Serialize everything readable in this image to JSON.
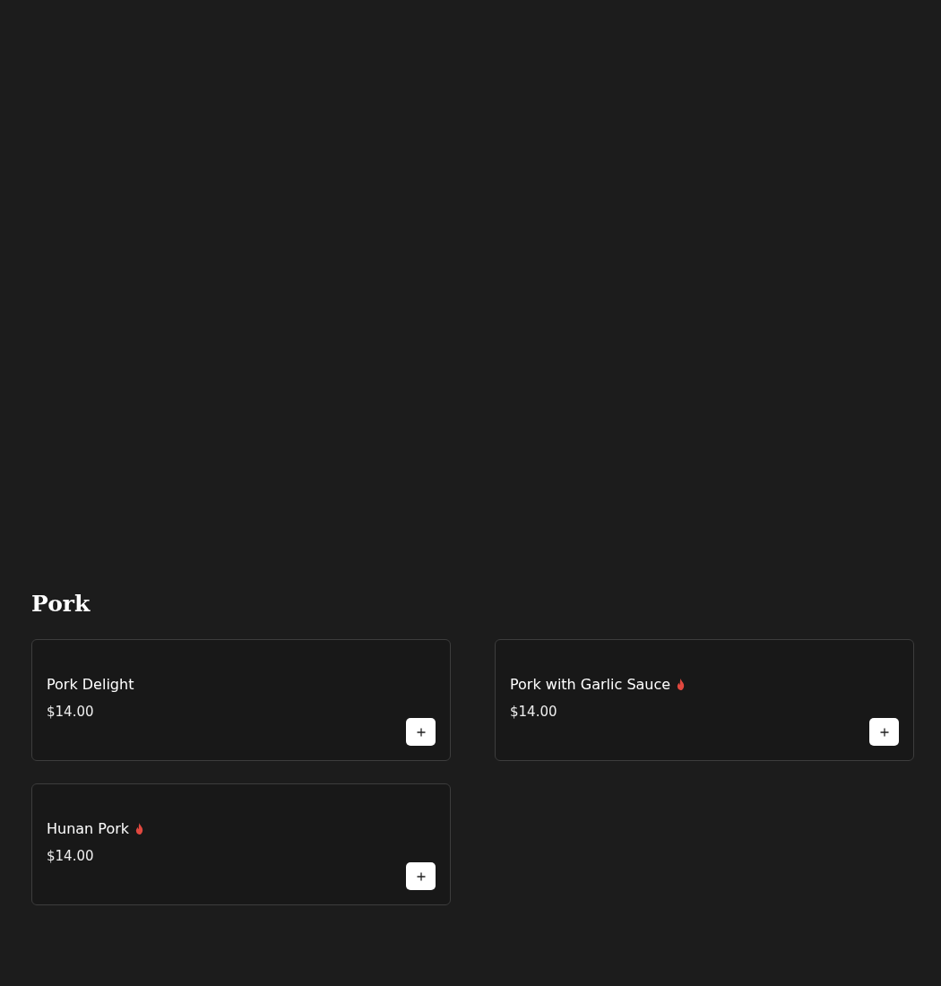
{
  "section": {
    "title": "Pork",
    "items": [
      {
        "name": "Pork Delight",
        "spicy": false,
        "price": "$14.00"
      },
      {
        "name": "Pork with Garlic Sauce",
        "spicy": true,
        "price": "$14.00"
      },
      {
        "name": "Hunan Pork",
        "spicy": true,
        "price": "$14.00"
      }
    ]
  }
}
